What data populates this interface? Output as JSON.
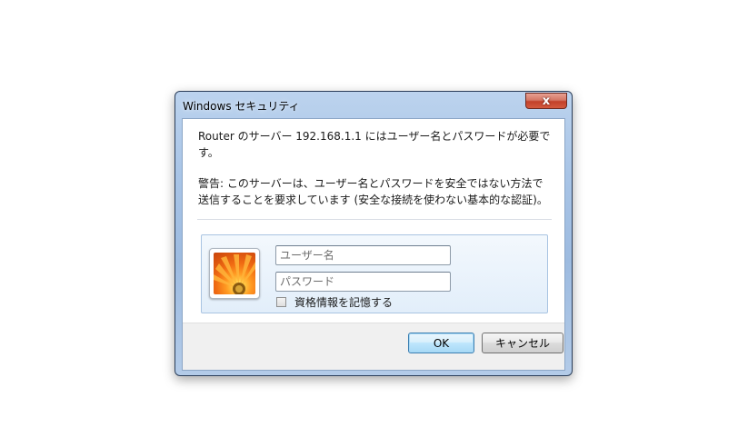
{
  "window": {
    "title": "Windows セキュリティ",
    "close_label": "x"
  },
  "message": {
    "line1": "Router のサーバー 192.168.1.1 にはユーザー名とパスワードが必要です。",
    "line2": "警告: このサーバーは、ユーザー名とパスワードを安全ではない方法で送信することを要求しています (安全な接続を使わない基本的な認証)。"
  },
  "credentials": {
    "username_placeholder": "ユーザー名",
    "password_placeholder": "パスワード",
    "remember_label": "資格情報を記憶する",
    "remember_checked": false
  },
  "buttons": {
    "ok": "OK",
    "cancel": "キャンセル"
  },
  "colors": {
    "title_bar": "#a8c4e6",
    "close_button": "#c2412a",
    "ok_button": "#bee6fd"
  }
}
